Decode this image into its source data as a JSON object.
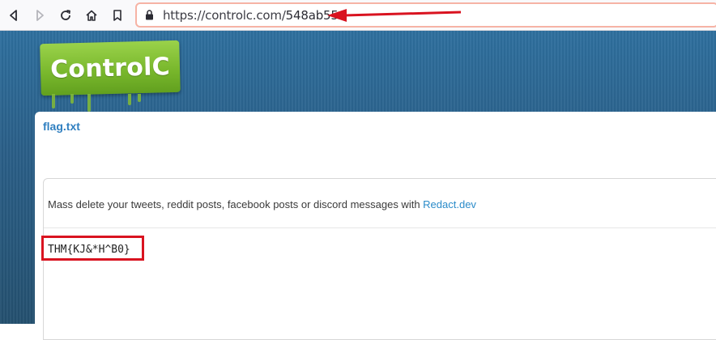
{
  "browser": {
    "url_host": "https://controlc.com/",
    "url_path": "548ab556",
    "nav_icons": [
      "back-icon",
      "forward-icon",
      "reload-icon",
      "home-icon",
      "bookmark-icon"
    ],
    "highlight_color": "#d91320"
  },
  "site": {
    "logo": "ControlC",
    "logo_color": "#77b62b"
  },
  "paste": {
    "title": "flag.txt",
    "ad_text": "Mass delete your tweets, reddit posts, facebook posts or discord messages with ",
    "ad_link": "Redact.dev",
    "content": "THM{KJ&*H^B0}"
  }
}
